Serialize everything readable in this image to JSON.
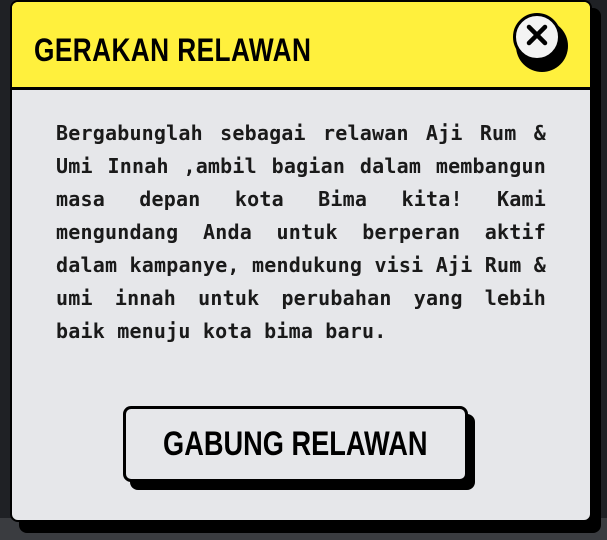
{
  "modal": {
    "title": "GERAKAN RELAWAN",
    "close_icon": "close-icon",
    "body_text": "Bergabunglah sebagai relawan Aji Rum & Umi Innah ,ambil bagian dalam membangun masa depan kota Bima kita! Kami mengundang Anda untuk berperan aktif dalam kampanye, mendukung visi Aji Rum & umi innah untuk perubahan yang lebih baik menuju kota bima baru.",
    "cta_label": "GABUNG RELAWAN"
  },
  "colors": {
    "header_bg": "#fff03d",
    "modal_bg": "#e6e7ea",
    "border": "#000000",
    "backdrop": "#1f2125"
  }
}
